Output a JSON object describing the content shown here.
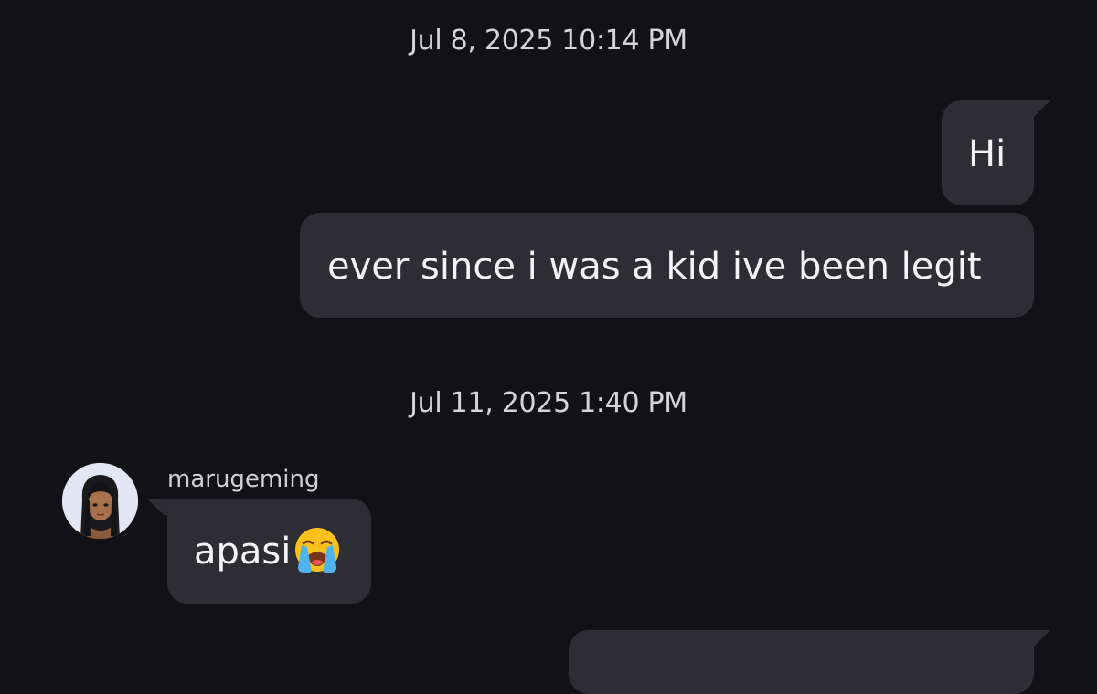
{
  "messages": {
    "timestamp_1": "Jul 8, 2025 10:14 PM",
    "outgoing_1": "Hi",
    "outgoing_2": "ever since i was a kid ive been legit",
    "timestamp_2": "Jul 11, 2025 1:40 PM",
    "incoming_1_sender": "marugeming",
    "incoming_1_text": "apasi",
    "incoming_1_emoji": "loudly-crying-face-emoji"
  },
  "colors": {
    "background": "#121216",
    "bubble": "#2d2d33",
    "text": "#f4f4f6",
    "timestamp": "#d4d4d9",
    "avatar_bg": "#e3e6f5"
  }
}
